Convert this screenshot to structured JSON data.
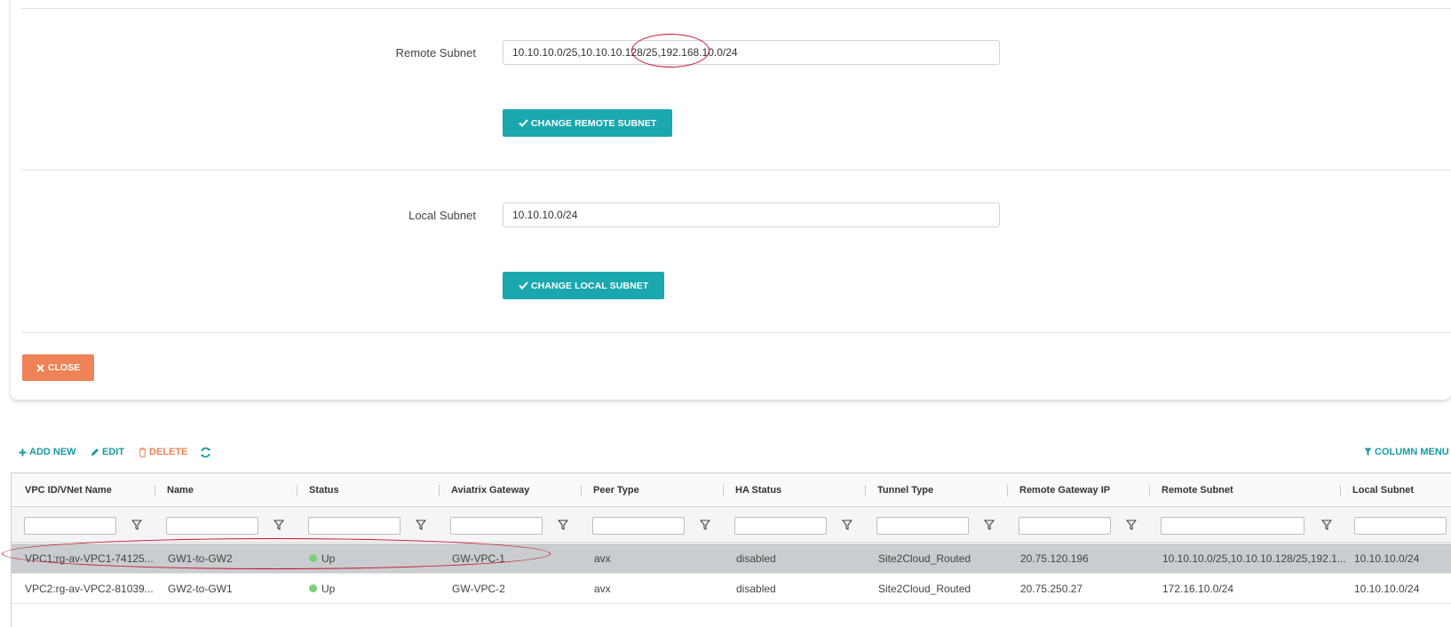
{
  "form": {
    "remote_subnet_label": "Remote Subnet",
    "remote_subnet_value": "10.10.10.0/25,10.10.10.128/25,192.168.10.0/24",
    "change_remote_label": "CHANGE REMOTE SUBNET",
    "local_subnet_label": "Local Subnet",
    "local_subnet_value": "10.10.10.0/24",
    "change_local_label": "CHANGE LOCAL SUBNET",
    "close_label": "CLOSE"
  },
  "toolbar": {
    "add_new": "ADD NEW",
    "edit": "EDIT",
    "delete": "DELETE",
    "column_menu": "COLUMN MENU"
  },
  "table": {
    "columns": [
      "VPC ID/VNet Name",
      "Name",
      "Status",
      "Aviatrix Gateway",
      "Peer Type",
      "HA Status",
      "Tunnel Type",
      "Remote Gateway IP",
      "Remote Subnet",
      "Local Subnet"
    ],
    "rows": [
      [
        "VPC1:rg-av-VPC1-74125...",
        "GW1-to-GW2",
        "Up",
        "GW-VPC-1",
        "avx",
        "disabled",
        "Site2Cloud_Routed",
        "20.75.120.196",
        "10.10.10.0/25,10.10.10.128/25,192.1...",
        "10.10.10.0/24"
      ],
      [
        "VPC2:rg-av-VPC2-81039...",
        "GW2-to-GW1",
        "Up",
        "GW-VPC-2",
        "avx",
        "disabled",
        "Site2Cloud_Routed",
        "20.75.250.27",
        "172.16.10.0/24",
        "10.10.10.0/24"
      ]
    ]
  },
  "colors": {
    "accent_teal": "#1ba7ae",
    "close_orange": "#ed8357",
    "status_up": "#7cd07c",
    "highlight_red": "#c8102e"
  }
}
